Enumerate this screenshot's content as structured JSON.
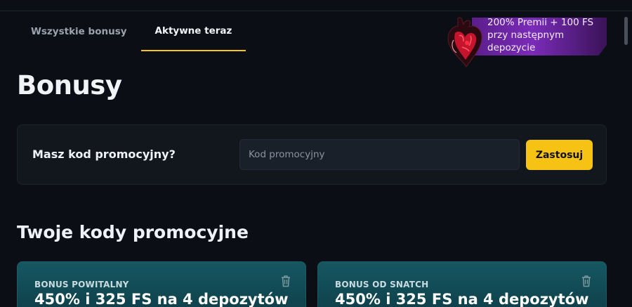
{
  "tabs": [
    {
      "label": "Wszystkie bonusy",
      "active": false
    },
    {
      "label": "Aktywne teraz",
      "active": true
    }
  ],
  "promo_banner": {
    "line1": "200% Premii + 100 FS",
    "line2": "przy następnym",
    "line3": "depozycie"
  },
  "page": {
    "title": "Bonusy"
  },
  "promo_code": {
    "label": "Masz kod promocyjny?",
    "placeholder": "Kod promocyjny",
    "value": "",
    "apply_label": "Zastosuj"
  },
  "section": {
    "title": "Twoje kody promocyjne"
  },
  "cards": [
    {
      "category": "BONUS POWITALNY",
      "title": "450% i 325 FS na 4 depozytów",
      "icon": "trash-icon"
    },
    {
      "category": "BONUS OD SNATCH",
      "title": "450% i 325 FS na 4 depozytów",
      "icon": "trash-icon"
    }
  ],
  "colors": {
    "accent": "#f6c315",
    "background": "#0b0f15",
    "card": "#155862",
    "banner": "#7a2bb8"
  }
}
